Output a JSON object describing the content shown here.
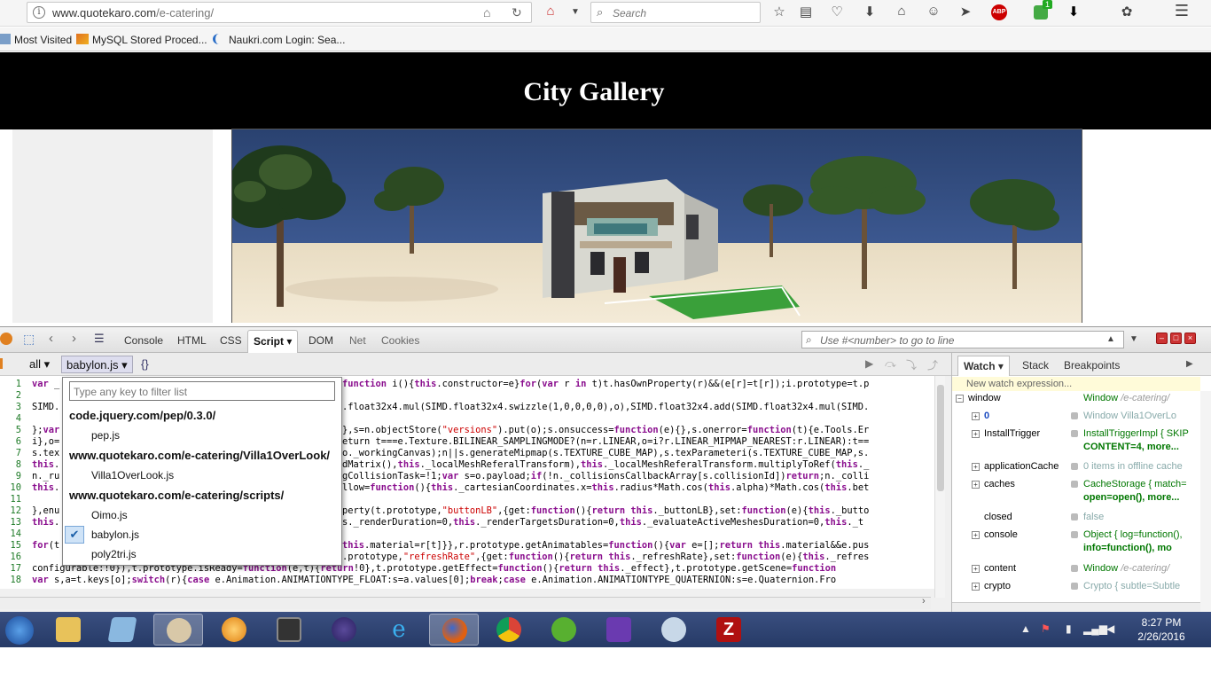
{
  "browser": {
    "url_host": "www.quotekaro.com",
    "url_path": "/e-catering/",
    "search_placeholder": "Search",
    "bookmarks": [
      "Most Visited",
      "MySQL Stored Proced...",
      "Naukri.com Login: Sea..."
    ],
    "badges": {
      "abp": "ABP",
      "notif": "1"
    }
  },
  "page": {
    "title": "City Gallery"
  },
  "firebug": {
    "tabs": [
      "Console",
      "HTML",
      "CSS",
      "Script",
      "DOM",
      "Net",
      "Cookies"
    ],
    "active_tab": "Script",
    "search_placeholder": "Use #<number> to go to line",
    "filter_all": "all",
    "script_file": "babylon.js",
    "pretty_print": "{}",
    "watch_tabs": [
      "Watch",
      "Stack",
      "Breakpoints"
    ],
    "new_watch": "New watch expression...",
    "watch_rows": [
      {
        "name": "window",
        "value": "Window /e-catering/",
        "toggle": "−"
      },
      {
        "name": "0",
        "value": "Window Villa1OverLo",
        "toggle": "+"
      },
      {
        "name": "InstallTrigger",
        "value": "InstallTriggerImpl {  SKIP",
        "value2": "CONTENT=4,  more...",
        "toggle": "+"
      },
      {
        "name": "applicationCache",
        "value": "0 items in offline cache",
        "toggle": "+"
      },
      {
        "name": "caches",
        "value": "CacheStorage {  match=",
        "value2": "open=open(),  more...",
        "toggle": "+"
      },
      {
        "name": "closed",
        "value": "false",
        "toggle": ""
      },
      {
        "name": "console",
        "value": "Object {  log=function(),",
        "value2": "info=function(),  mo",
        "toggle": "+"
      },
      {
        "name": "content",
        "value": "Window /e-catering/",
        "toggle": "+"
      },
      {
        "name": "crypto",
        "value": "Crypto {  subtle=Subtle",
        "toggle": "+"
      }
    ]
  },
  "dropdown": {
    "filter_placeholder": "Type any key to filter list",
    "groups": [
      {
        "label": "code.jquery.com/pep/0.3.0/",
        "items": [
          "pep.js"
        ]
      },
      {
        "label": "www.quotekaro.com/e-catering/Villa1OverLook/",
        "items": [
          "Villa1OverLook.js"
        ]
      },
      {
        "label": "www.quotekaro.com/e-catering/scripts/",
        "items": [
          "Oimo.js",
          "babylon.js",
          "poly2tri.js"
        ]
      }
    ],
    "selected": "babylon.js"
  },
  "code_lines": [
    {
      "n": "1",
      "pre": "var _",
      "post": "function i(){this.constructor=e}for(var r in t)t.hasOwnProperty(r)&&(e[r]=t[r]);i.prototype=t.p"
    },
    {
      "n": "2",
      "pre": "",
      "post": ""
    },
    {
      "n": "3",
      "pre": "SIMD.",
      "post": ".float32x4.mul(SIMD.float32x4.swizzle(1,0,0,0,0),o),SIMD.float32x4.add(SIMD.float32x4.mul(SIMD."
    },
    {
      "n": "4",
      "pre": "",
      "post": ""
    },
    {
      "n": "5",
      "pre": "};var",
      "post": "},s=n.objectStore(\"versions\").put(o);s.onsuccess=function(e){},s.onerror=function(t){e.Tools.Er"
    },
    {
      "n": "6",
      "pre": "i},o=",
      "post": "eturn t===e.Texture.BILINEAR_SAMPLINGMODE?(n=r.LINEAR,o=i?r.LINEAR_MIPMAP_NEAREST:r.LINEAR):t=="
    },
    {
      "n": "7",
      "pre": "s.tex",
      "post": "o._workingCanvas);n||s.generateMipmap(s.TEXTURE_CUBE_MAP),s.texParameteri(s.TEXTURE_CUBE_MAP,s."
    },
    {
      "n": "8",
      "pre": "this.",
      "post": "dMatrix(),this._localMeshReferalTransform),this._localMeshReferalTransform.multiplyToRef(this._"
    },
    {
      "n": "9",
      "pre": "n._ru",
      "post": "gCollisionTask=!1;var s=o.payload;if(!n._collisionsCallbackArray[s.collisionId])return;n._colli"
    },
    {
      "n": "10",
      "pre": "this.",
      "post": "llow=function(){this._cartesianCoordinates.x=this.radius*Math.cos(this.alpha)*Math.cos(this.bet"
    },
    {
      "n": "11",
      "pre": "",
      "post": ""
    },
    {
      "n": "12",
      "pre": "},enu",
      "post": "perty(t.prototype,\"buttonLB\",{get:function(){return this._buttonLB},set:function(e){this._butto"
    },
    {
      "n": "13",
      "pre": "this.",
      "post": "s._renderDuration=0,this._renderTargetsDuration=0,this._evaluateActiveMeshesDuration=0,this._t"
    },
    {
      "n": "14",
      "pre": "",
      "post": ""
    },
    {
      "n": "15",
      "pre": "for(t",
      "post": "this.material=r[t]}},r.prototype.getAnimatables=function(){var e=[];return this.material&&e.pus"
    },
    {
      "n": "16",
      "pre": "",
      "post": ".prototype,\"refreshRate\",{get:function(){return this._refreshRate},set:function(e){this._refres"
    },
    {
      "n": "17",
      "pre": "configurable:!0}),t.prototype.isReady=function(e,t){return!0},t.prototype.getEffect=function(){return this._effect},t.prototype.getScene=function",
      "post": ""
    },
    {
      "n": "18",
      "pre": "var s,a=t.keys[o];switch(r){case e.Animation.ANIMATIONTYPE_FLOAT:s=a.values[0];break;case e.Animation.ANIMATIONTYPE_QUATERNION:s=e.Quaternion.Fro",
      "post": ""
    }
  ],
  "taskbar": {
    "time": "8:27 PM",
    "date": "2/26/2016",
    "apps": [
      "start",
      "explorer",
      "notepad",
      "paint",
      "vlc",
      "media-321",
      "eclipse",
      "ie",
      "firefox",
      "chrome",
      "utorrent",
      "visual-studio",
      "snipping-tool",
      "filezilla"
    ],
    "active_apps": [
      "paint",
      "firefox"
    ]
  }
}
